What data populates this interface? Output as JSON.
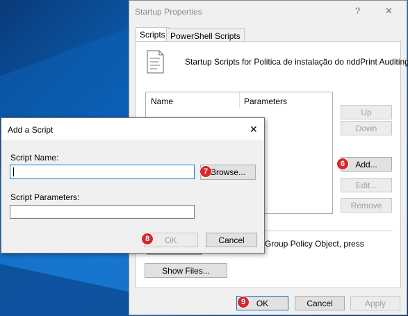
{
  "startup_dialog": {
    "title": "Startup Properties",
    "help_label": "?",
    "close_label": "✕",
    "tabs": [
      {
        "label": "Scripts"
      },
      {
        "label": "PowerShell Scripts"
      }
    ],
    "heading": "Startup Scripts for Politica de instalação do nddPrint Auditing",
    "columns": [
      "Name",
      "Parameters"
    ],
    "side_buttons": {
      "up": "Up",
      "down": "Down",
      "add": "Add...",
      "edit": "Edit...",
      "remove": "Remove"
    },
    "info_text": "Group Policy Object, press",
    "show_files": "Show Files...",
    "footer": {
      "ok": "OK",
      "cancel": "Cancel",
      "apply": "Apply"
    }
  },
  "add_script_dialog": {
    "title": "Add a Script",
    "close_label": "✕",
    "script_name_label": "Script Name:",
    "script_name_value": "",
    "browse_label": "Browse...",
    "params_label": "Script Parameters:",
    "params_value": "",
    "ok": "OK",
    "cancel": "Cancel"
  },
  "badges": {
    "six": "6",
    "seven": "7",
    "eight": "8",
    "nine": "9"
  },
  "colors": {
    "badge": "#d9262a",
    "focus_border": "#0078d7",
    "desktop_blue": "#0b5fb0"
  }
}
